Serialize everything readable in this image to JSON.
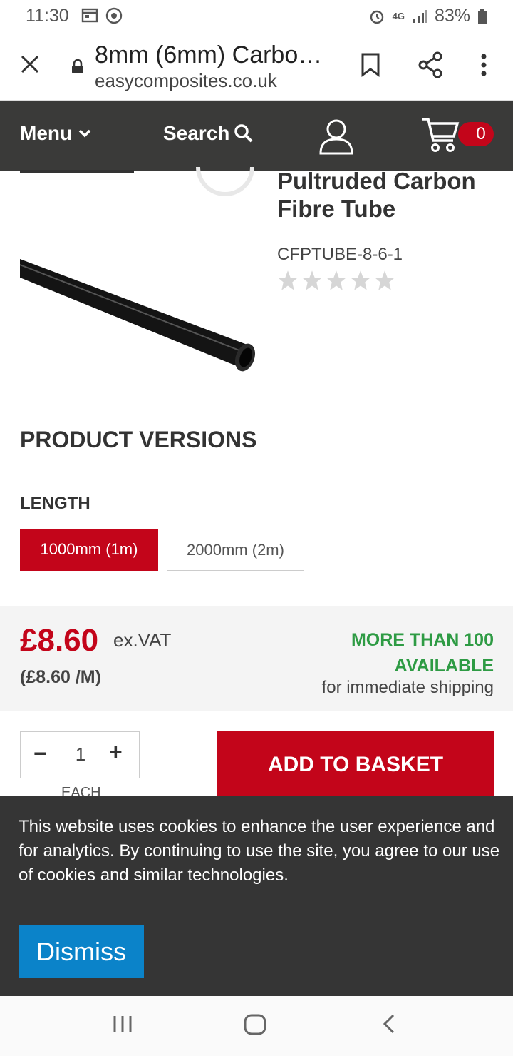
{
  "status_bar": {
    "time": "11:30",
    "network": "4G",
    "battery": "83%"
  },
  "browser": {
    "tab_title": "8mm (6mm) Carbo…",
    "url": "easycomposites.co.uk"
  },
  "header": {
    "menu_label": "Menu",
    "search_label": "Search",
    "cart_count": "0"
  },
  "product": {
    "title": "Pultruded Carbon Fibre Tube",
    "sku": "CFPTUBE-8-6-1",
    "rating": 0,
    "rating_max": 5
  },
  "versions": {
    "heading": "PRODUCT VERSIONS",
    "length_label": "LENGTH",
    "options": [
      "1000mm (1m)",
      "2000mm (2m)"
    ],
    "selected": "1000mm (1m)"
  },
  "pricing": {
    "price": "£8.60",
    "vat_note": "ex.VAT",
    "per_unit": "(£8.60 /M)",
    "stock_line1": "MORE THAN 100",
    "stock_line2": "AVAILABLE",
    "shipping": "for immediate shipping"
  },
  "purchase": {
    "quantity": "1",
    "minus": "−",
    "plus": "+",
    "unit_label": "EACH",
    "add_to_basket": "ADD TO BASKET"
  },
  "cookie": {
    "text": "This website uses cookies to enhance the user experience and for analytics. By continuing to use the site, you agree to our use of cookies and similar technologies.",
    "dismiss": "Dismiss"
  },
  "colors": {
    "brand_red": "#c3051a",
    "header_dark": "#3a3a39",
    "stock_green": "#2e9b44",
    "dismiss_blue": "#0b83c9"
  }
}
